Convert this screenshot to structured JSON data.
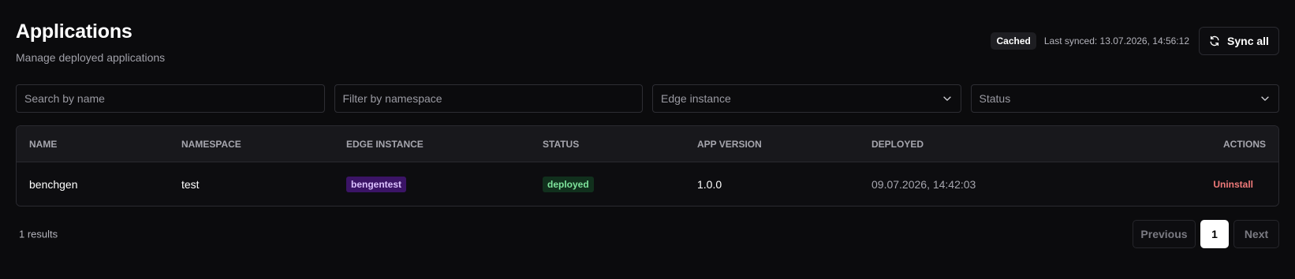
{
  "header": {
    "title": "Applications",
    "subtitle": "Manage deployed applications"
  },
  "sync": {
    "cached_label": "Cached",
    "last_synced": "Last synced: 13.07.2026, 14:56:12",
    "sync_all_label": "Sync all",
    "icon": "refresh-icon"
  },
  "filters": {
    "search_placeholder": "Search by name",
    "namespace_placeholder": "Filter by namespace",
    "edge_instance_value": "Edge instance",
    "status_value": "Status"
  },
  "table": {
    "columns": [
      "NAME",
      "NAMESPACE",
      "EDGE INSTANCE",
      "STATUS",
      "APP VERSION",
      "DEPLOYED",
      "ACTIONS"
    ],
    "rows": [
      {
        "name": "benchgen",
        "namespace": "test",
        "edge_instance": "bengentest",
        "status": "deployed",
        "app_version": "1.0.0",
        "deployed": "09.07.2026, 14:42:03",
        "action": "Uninstall"
      }
    ]
  },
  "footer": {
    "results": "1 results",
    "previous_label": "Previous",
    "current_page": "1",
    "next_label": "Next"
  },
  "colors": {
    "background": "#0b0b0d",
    "edge_badge_bg": "#3b1466",
    "status_badge_bg": "#11301d",
    "status_badge_text": "#7ee49c",
    "danger": "#f07a7a"
  }
}
